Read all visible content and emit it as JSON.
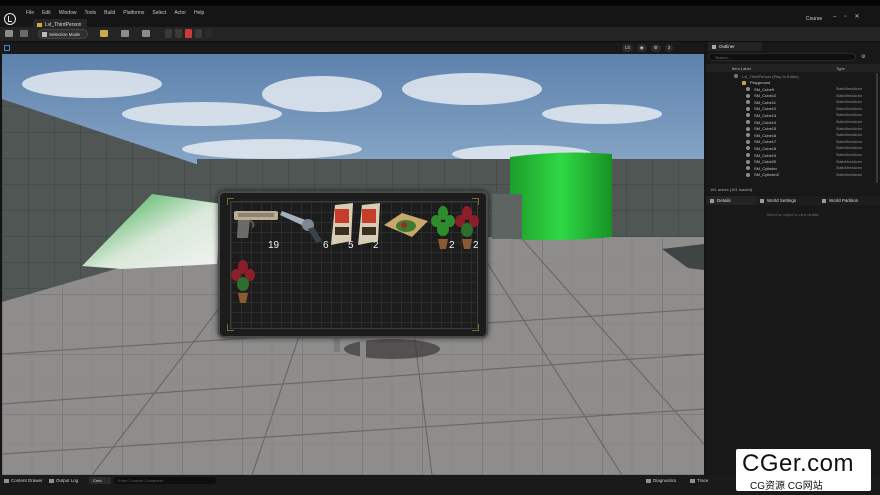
{
  "menubar": {
    "items": [
      "File",
      "Edit",
      "Window",
      "Tools",
      "Build",
      "Platforms",
      "Select",
      "Actor",
      "Help"
    ],
    "map_tab": "Lvl_ThirdPerson",
    "project": "Course"
  },
  "toolbar": {
    "mode_label": "Selection Mode"
  },
  "viewport": {
    "perspective_label": "Lit",
    "zoom_label": "3"
  },
  "inventory": {
    "counts": [
      "19",
      "6",
      "5",
      "2",
      "2",
      "2"
    ],
    "items": [
      "pistol-item",
      "revolver-item",
      "ammo-box-item",
      "ammo-box-item",
      "herb-bundle-item",
      "green-plant-item",
      "red-plant-item",
      "red-plant-item"
    ]
  },
  "outliner": {
    "tab": "Outliner",
    "search_placeholder": "Search...",
    "col_label": "Item Label",
    "col_type": "Type",
    "root": "Lvl_ThirdPerson (Play In Editor)",
    "folder": "Playground",
    "rows": [
      {
        "name": "SM_Cube9",
        "type": "StaticMeshActor"
      },
      {
        "name": "SM_Cube10",
        "type": "StaticMeshActor"
      },
      {
        "name": "SM_Cube11",
        "type": "StaticMeshActor"
      },
      {
        "name": "SM_Cube12",
        "type": "StaticMeshActor"
      },
      {
        "name": "SM_Cube13",
        "type": "StaticMeshActor"
      },
      {
        "name": "SM_Cube14",
        "type": "StaticMeshActor"
      },
      {
        "name": "SM_Cube15",
        "type": "StaticMeshActor"
      },
      {
        "name": "SM_Cube16",
        "type": "StaticMeshActor"
      },
      {
        "name": "SM_Cube17",
        "type": "StaticMeshActor"
      },
      {
        "name": "SM_Cube18",
        "type": "StaticMeshActor"
      },
      {
        "name": "SM_Cube19",
        "type": "StaticMeshActor"
      },
      {
        "name": "SM_Cube20",
        "type": "StaticMeshActor"
      },
      {
        "name": "SM_Cylinder",
        "type": "StaticMeshActor"
      },
      {
        "name": "SM_Cylinder2",
        "type": "StaticMeshActor"
      }
    ],
    "actor_count": "161 actors (161 loaded)"
  },
  "details": {
    "tabs": [
      "Details",
      "World Settings",
      "World Partition"
    ],
    "empty_text": "Select an object to view details."
  },
  "bottombar": {
    "content_drawer": "Content Drawer",
    "output_log": "Output Log",
    "cmd": "Cmd",
    "console_placeholder": "Enter Console Command",
    "diagnostics": "Diagnostics",
    "trace": "Trace",
    "derived": "Derived Data",
    "unsaved": "Unsaved",
    "revision": "Revision Control"
  },
  "watermark": {
    "big": "CGer.com",
    "small": "CG资源 CG网站"
  }
}
